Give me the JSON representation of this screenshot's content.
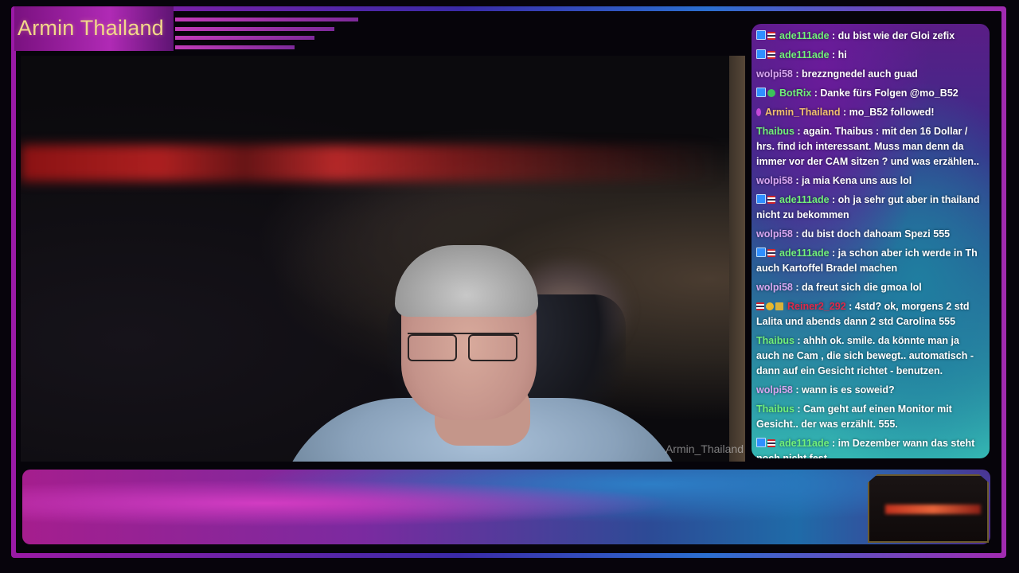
{
  "stream": {
    "title": "Armin Thailand",
    "cam_watermark": "Armin_Thailand"
  },
  "chat": {
    "messages": [
      {
        "badges": [
          "prime",
          "thai-flag"
        ],
        "user": "ade111ade",
        "color": "green",
        "text": "du bist wie der Gloi zefix"
      },
      {
        "badges": [
          "prime",
          "thai-flag"
        ],
        "user": "ade111ade",
        "color": "green",
        "text": "hi"
      },
      {
        "badges": [],
        "user": "wolpi58",
        "color": "pink",
        "text": "brezzngnedel auch guad"
      },
      {
        "badges": [
          "prime",
          "verified"
        ],
        "user": "BotRix",
        "color": "green",
        "text": "Danke fürs Folgen @mo_B52"
      },
      {
        "badges": [
          "moderator"
        ],
        "user": "Armin_Thailand",
        "color": "orange",
        "text": "mo_B52 followed!"
      },
      {
        "badges": [],
        "user": "Thaibus",
        "color": "green",
        "text": "again. Thaibus : mit den 16 Dollar / hrs. find ich interessant. Muss man denn da immer vor der CAM sitzen ? und was erzählen.."
      },
      {
        "badges": [],
        "user": "wolpi58",
        "color": "pink",
        "text": "ja mia Kena uns aus lol"
      },
      {
        "badges": [
          "prime",
          "thai-flag"
        ],
        "user": "ade111ade",
        "color": "green",
        "text": "oh ja sehr gut aber in thailand nicht zu bekommen"
      },
      {
        "badges": [],
        "user": "wolpi58",
        "color": "pink",
        "text": "du bist doch dahoam Spezi 555"
      },
      {
        "badges": [
          "prime",
          "thai-flag"
        ],
        "user": "ade111ade",
        "color": "green",
        "text": "ja schon aber ich werde in Th auch Kartoffel Bradel machen"
      },
      {
        "badges": [],
        "user": "wolpi58",
        "color": "pink",
        "text": "da freut sich die gmoa lol"
      },
      {
        "badges": [
          "thai-flag",
          "gold-coin",
          "crown"
        ],
        "user": "Reiner2_292",
        "color": "red",
        "text": "4std? ok, morgens 2 std Lalita und abends dann 2 std Carolina 555"
      },
      {
        "badges": [],
        "user": "Thaibus",
        "color": "green",
        "text": "ahhh ok. smile. da könnte man ja auch ne Cam , die sich bewegt.. automatisch - dann auf ein Gesicht richtet - benutzen."
      },
      {
        "badges": [],
        "user": "wolpi58",
        "color": "pink",
        "text": "wann is es soweid?"
      },
      {
        "badges": [],
        "user": "Thaibus",
        "color": "green",
        "text": "Cam geht auf einen Monitor mit Gesicht.. der was erzählt. 555."
      },
      {
        "badges": [
          "prime",
          "thai-flag"
        ],
        "user": "ade111ade",
        "color": "green",
        "text": "im Dezember wann das steht noch nicht fest"
      }
    ]
  }
}
